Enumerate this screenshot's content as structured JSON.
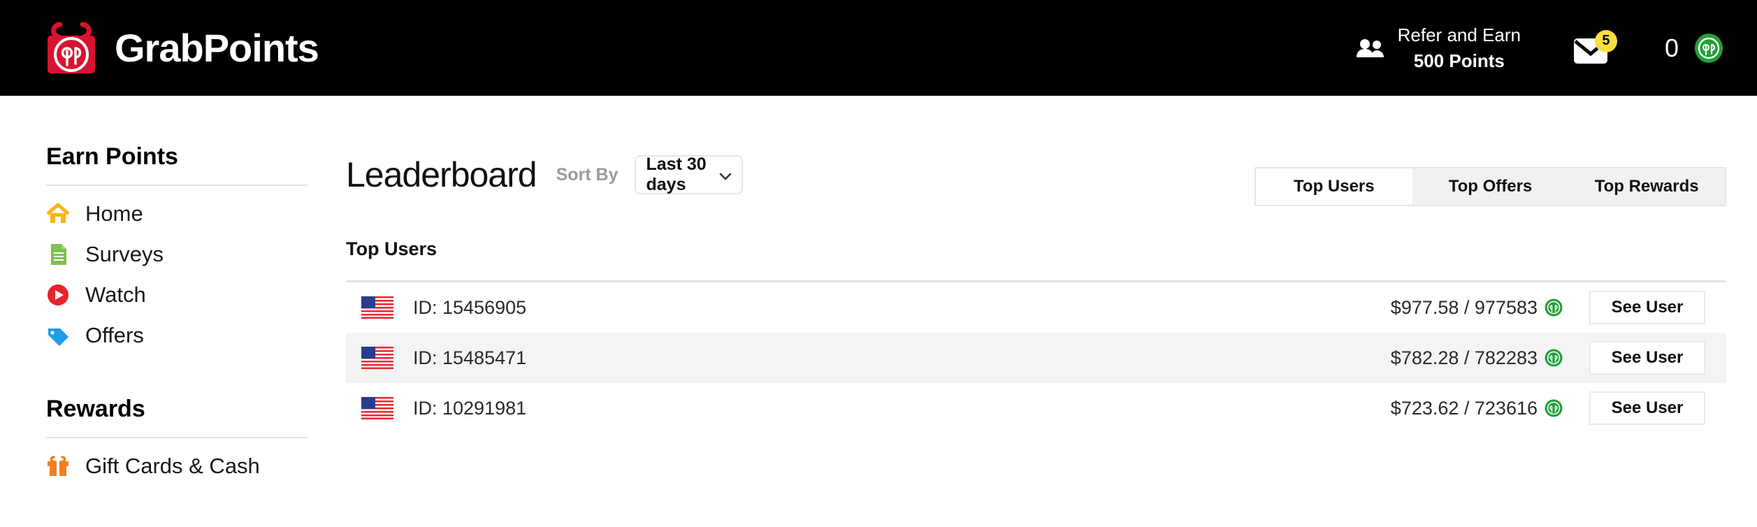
{
  "header": {
    "brand_name": "GrabPoints",
    "logo_icon": "gift-box-gp-logo",
    "refer": {
      "icon": "people-icon",
      "line1": "Refer and Earn",
      "line2": "500 Points"
    },
    "messages": {
      "icon": "envelope-icon",
      "badge_count": "5"
    },
    "points": {
      "value": "0",
      "icon": "gp-coin-icon"
    }
  },
  "sidebar": {
    "sections": [
      {
        "title": "Earn Points",
        "items": [
          {
            "label": "Home",
            "icon": "home-icon"
          },
          {
            "label": "Surveys",
            "icon": "document-icon"
          },
          {
            "label": "Watch",
            "icon": "play-circle-icon"
          },
          {
            "label": "Offers",
            "icon": "tag-icon"
          }
        ]
      },
      {
        "title": "Rewards",
        "items": [
          {
            "label": "Gift Cards & Cash",
            "icon": "gift-icon"
          }
        ]
      }
    ]
  },
  "main": {
    "title": "Leaderboard",
    "sort_label": "Sort By",
    "sort_value": "Last 30 days",
    "sort_options": [
      "Last 30 days"
    ],
    "tabs": [
      {
        "label": "Top Users",
        "active": true
      },
      {
        "label": "Top Offers",
        "active": false
      },
      {
        "label": "Top Rewards",
        "active": false
      }
    ],
    "section_heading": "Top Users",
    "rows": [
      {
        "flag": "us-flag-icon",
        "user_id": "ID: 15456905",
        "amount": "$977.58 / 977583",
        "coin_icon": "gp-coin-icon",
        "button_label": "See User"
      },
      {
        "flag": "us-flag-icon",
        "user_id": "ID: 15485471",
        "amount": "$782.28 / 782283",
        "coin_icon": "gp-coin-icon",
        "button_label": "See User"
      },
      {
        "flag": "us-flag-icon",
        "user_id": "ID: 10291981",
        "amount": "$723.62 / 723616",
        "coin_icon": "gp-coin-icon",
        "button_label": "See User"
      }
    ]
  },
  "colors": {
    "header_bg": "#000000",
    "brand_red": "#d8132f",
    "badge_yellow": "#fadf41",
    "coin_green": "#21a038",
    "row_alt": "#f4f4f4"
  }
}
